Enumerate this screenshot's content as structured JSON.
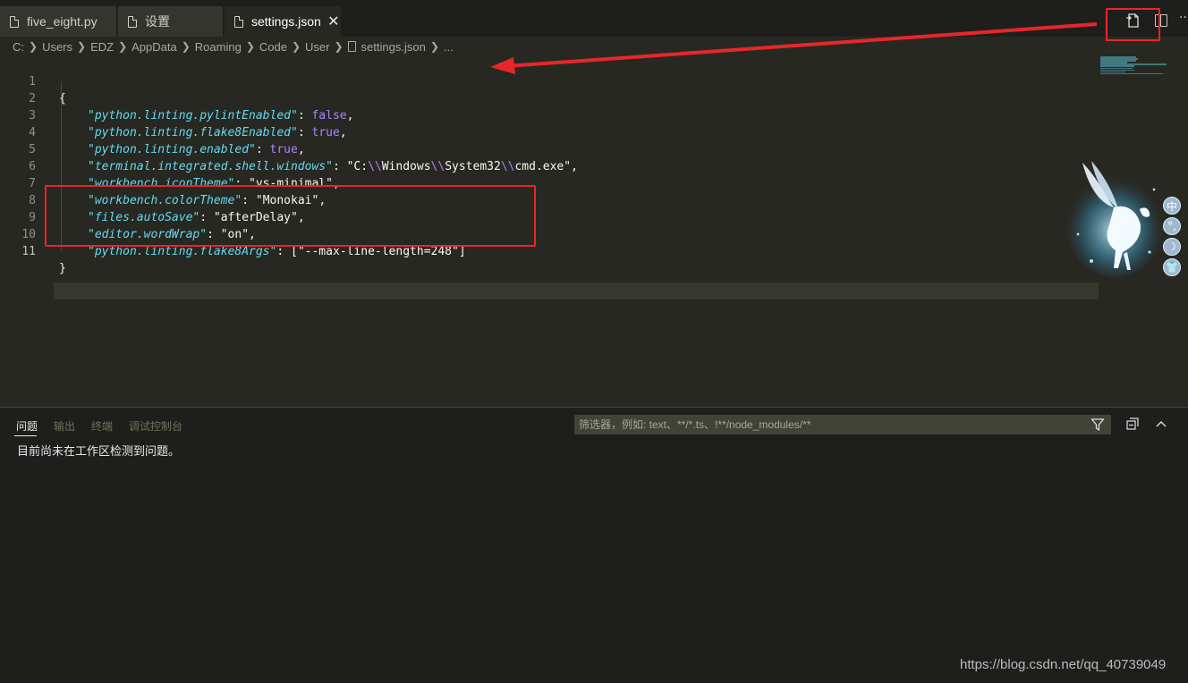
{
  "tabs": [
    {
      "label": "five_eight.py",
      "active": false
    },
    {
      "label": "设置",
      "active": false
    },
    {
      "label": "settings.json",
      "active": true,
      "close": "✕"
    }
  ],
  "breadcrumb": {
    "items": [
      "C:",
      "Users",
      "EDZ",
      "AppData",
      "Roaming",
      "Code",
      "User",
      "settings.json",
      "..."
    ]
  },
  "editor": {
    "line_numbers": [
      "1",
      "2",
      "3",
      "4",
      "5",
      "6",
      "7",
      "8",
      "9",
      "10",
      "11"
    ],
    "lines": {
      "l1": {
        "open": "{"
      },
      "l2": {
        "key": "python.linting.pylintEnabled",
        "value": "false"
      },
      "l3": {
        "key": "python.linting.flake8Enabled",
        "value": "true"
      },
      "l4": {
        "key": "python.linting.enabled",
        "value": "true"
      },
      "l5": {
        "key": "terminal.integrated.shell.windows",
        "v1": "C:",
        "v2": "Windows",
        "v3": "System32",
        "v4": "cmd.exe"
      },
      "l6": {
        "key": "workbench.iconTheme",
        "value": "vs-minimal"
      },
      "l7": {
        "key": "workbench.colorTheme",
        "value": "Monokai"
      },
      "l8": {
        "key": "files.autoSave",
        "value": "afterDelay"
      },
      "l9": {
        "key": "editor.wordWrap",
        "value": "on"
      },
      "l10": {
        "key": "python.linting.flake8Args",
        "value": "--max-line-length=248"
      },
      "l11": {
        "close": "}"
      }
    },
    "current_line": 11
  },
  "side_buttons": [
    "中",
    "°,",
    "☽",
    "👕"
  ],
  "panel": {
    "tabs": [
      {
        "label": "问题",
        "active": true
      },
      {
        "label": "输出",
        "active": false
      },
      {
        "label": "终端",
        "active": false
      },
      {
        "label": "调试控制台",
        "active": false
      }
    ],
    "filter_placeholder": "筛选器，例如: text、**/*.ts、!**/node_modules/**",
    "message": "目前尚未在工作区检测到问题。"
  },
  "watermark": "https://blog.csdn.net/qq_40739049",
  "colors": {
    "annotation_red": "#e8262a",
    "keyword": "#66d9ef",
    "boolean": "#ae81ff",
    "background": "#272822"
  }
}
